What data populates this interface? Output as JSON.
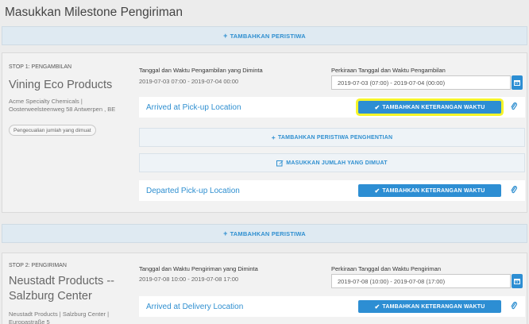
{
  "page": {
    "title": "Masukkan Milestone Pengiriman"
  },
  "add_event": {
    "label": "TAMBAHKAN PERISTIWA"
  },
  "stops": [
    {
      "label": "STOP 1: PENGAMBILAN",
      "name": "Vining Eco Products",
      "address": "Acme Specialty Chemicals | Oosterweelsteenweg 58 Antwerpen , BE",
      "exclusion_pill": "Pengecualian jumlah yang dimuat",
      "requested_label": "Tanggal dan Waktu Pengambilan yang Diminta",
      "requested_value": "2019-07-03 07:00 - 2019-07-04 00:00",
      "estimated_label": "Perkiraan Tanggal dan Waktu Pengambilan",
      "estimated_value": "2019-07-03 (07:00) - 2019-07-04 (00:00)",
      "events": [
        {
          "name": "Arrived at Pick-up Location",
          "button": "TAMBAHKAN KETERANGAN WAKTU"
        },
        {
          "name": "Departed Pick-up Location",
          "button": "TAMBAHKAN KETERANGAN WAKTU"
        }
      ],
      "add_stop_event": "TAMBAHKAN PERISTIWA PENGHENTIAN",
      "enter_loaded_qty": "MASUKKAN JUMLAH YANG DIMUAT"
    },
    {
      "label": "STOP 2: PENGIRIMAN",
      "name": "Neustadt Products -- Salzburg Center",
      "address": "Neustadt Products | Salzburg Center | Europastraße 5",
      "requested_label": "Tanggal dan Waktu Pengiriman yang Diminta",
      "requested_value": "2019-07-08 10:00 - 2019-07-08 17:00",
      "estimated_label": "Perkiraan Tanggal dan Waktu Pengiriman",
      "estimated_value": "2019-07-08 (10:00) - 2019-07-08 (17:00)",
      "events": [
        {
          "name": "Arrived at Delivery Location",
          "button": "TAMBAHKAN KETERANGAN WAKTU"
        }
      ]
    }
  ],
  "icons": {
    "plus": "plus-icon",
    "check": "check-icon",
    "calendar": "calendar-icon",
    "paperclip": "paperclip-icon",
    "edit": "edit-icon"
  },
  "colors": {
    "accent": "#2d8ed3",
    "highlight": "#f5f52a"
  }
}
